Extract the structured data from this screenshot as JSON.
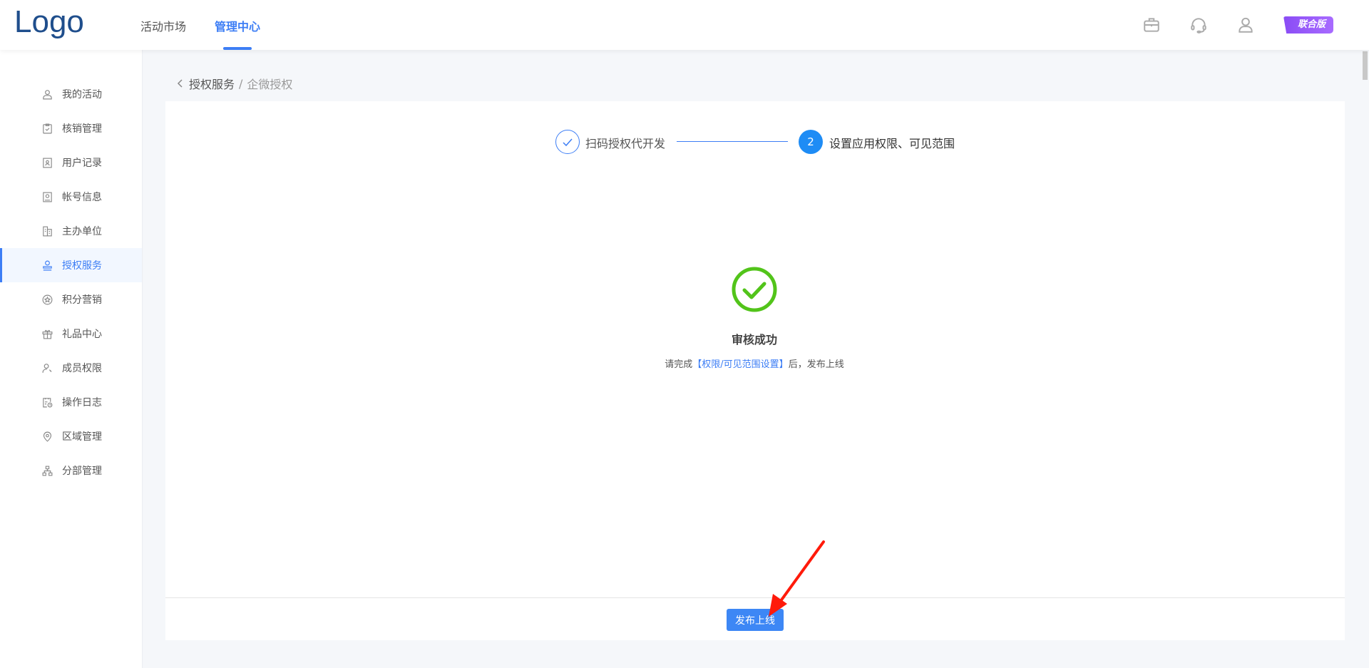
{
  "header": {
    "logo": "Logo",
    "nav": [
      "活动市场",
      "管理中心"
    ],
    "active_nav": 1,
    "badge": "联合版",
    "icons": [
      "briefcase-icon",
      "headset-icon",
      "user-icon"
    ]
  },
  "sidebar": {
    "items": [
      {
        "label": "我的活动",
        "icon": "user-icon"
      },
      {
        "label": "核销管理",
        "icon": "clipboard-check-icon"
      },
      {
        "label": "用户记录",
        "icon": "id-card-icon"
      },
      {
        "label": "帐号信息",
        "icon": "account-icon"
      },
      {
        "label": "主办单位",
        "icon": "building-icon"
      },
      {
        "label": "授权服务",
        "icon": "stamp-icon",
        "active": true
      },
      {
        "label": "积分营销",
        "icon": "star-badge-icon"
      },
      {
        "label": "礼品中心",
        "icon": "gift-icon"
      },
      {
        "label": "成员权限",
        "icon": "user-key-icon"
      },
      {
        "label": "操作日志",
        "icon": "log-icon"
      },
      {
        "label": "区域管理",
        "icon": "location-icon"
      },
      {
        "label": "分部管理",
        "icon": "org-chart-icon"
      }
    ]
  },
  "breadcrumb": {
    "parent": "授权服务",
    "separator": "/",
    "current": "企微授权"
  },
  "steps": [
    {
      "label": "扫码授权代开发",
      "status": "done"
    },
    {
      "number": "2",
      "label": "设置应用权限、可见范围",
      "status": "active"
    }
  ],
  "result": {
    "title": "审核成功",
    "desc_prefix": "请完成",
    "desc_link": "【权限/可见范围设置】",
    "desc_suffix": "后，发布上线"
  },
  "footer": {
    "publish_button": "发布上线"
  },
  "colors": {
    "primary": "#3d7ef5",
    "success": "#52c41a",
    "badge": "#9b5cfb",
    "arrow": "#ff1a0a"
  }
}
